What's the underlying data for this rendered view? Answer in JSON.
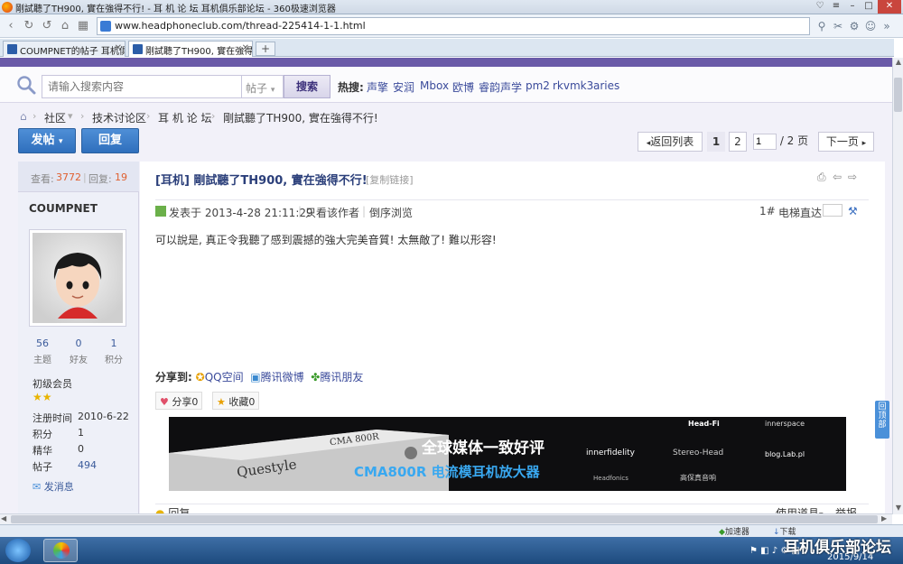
{
  "window": {
    "title": "剛試聽了TH900, 實在強得不行! - 耳 机 论 坛 耳机俱乐部论坛 - 360极速浏览器"
  },
  "browser": {
    "url": "www.headphoneclub.com/thread-225414-1-1.html",
    "tabs": [
      {
        "label": "COUMPNET的帖子 耳机俱乐"
      },
      {
        "label": "剛試聽了TH900, 實在強得"
      }
    ],
    "new_tab": "+"
  },
  "search": {
    "placeholder": "请输入搜索内容",
    "type": "帖子",
    "button": "搜索",
    "hot_label": "热搜:",
    "hot_terms": [
      "声擎",
      "安润",
      "Mbox",
      "欧博",
      "睿韵声学",
      "pm2",
      "rkvmk3",
      "aries"
    ]
  },
  "breadcrumb": [
    "社区",
    "技术讨论区",
    "耳 机 论 坛",
    "剛試聽了TH900, 實在強得不行!"
  ],
  "actions": {
    "post": "发帖",
    "reply": "回复"
  },
  "pagination": {
    "back": "返回列表",
    "pages": [
      "1",
      "2"
    ],
    "current": "1",
    "total": "/ 2 页",
    "next": "下一页"
  },
  "thread_stats": {
    "views_label": "查看:",
    "views": "3772",
    "sep": "|",
    "replies_label": "回复:",
    "replies": "19"
  },
  "author": {
    "name": "COUMPNET",
    "stats": [
      {
        "value": "56",
        "label": "主题"
      },
      {
        "value": "0",
        "label": "好友"
      },
      {
        "value": "1",
        "label": "积分"
      }
    ],
    "rank": "初级会员",
    "info": [
      {
        "label": "注册时间",
        "value": "2010-6-22"
      },
      {
        "label": "积分",
        "value": "1"
      },
      {
        "label": "精华",
        "value": "0"
      },
      {
        "label": "帖子",
        "value": "494"
      }
    ],
    "message": "发消息"
  },
  "post": {
    "title": "[耳机]  剛試聽了TH900, 實在強得不行!",
    "copy_link": "[复制链接]",
    "posted": "发表于 2013-4-28 21:11:29",
    "only_author": "只看该作者",
    "reverse": "倒序浏览",
    "floor": "1#",
    "elevator": "电梯直达",
    "body": "可以說是, 真正令我聽了感到震撼的強大完美音質! 太無敵了! 難以形容!",
    "share_label": "分享到:",
    "share_targets": [
      "QQ空间",
      "腾讯微博",
      "腾讯朋友"
    ],
    "share_btn": "分享0",
    "fav_btn": "收藏0",
    "reply_link": "回复",
    "use_tools": "使用道具",
    "report": "举报"
  },
  "banner": {
    "headline": "全球媒体一致好评",
    "subline": "CMA800R 电流模耳机放大器",
    "brand": "Questyle",
    "model": "CMA 800R",
    "logos": [
      "Head-Fi",
      "innerspace",
      "innerfidelity",
      "Stereo-Head",
      "blog.Lab.pl",
      "Headfonics",
      "高保真音响"
    ]
  },
  "side_tab": "回顶部",
  "status": {
    "accelerator": "加速器",
    "download": "下载"
  },
  "watermark": "耳机俱乐部论坛",
  "taskbar": {
    "date": "2015/9/14"
  },
  "colors": {
    "nav": "#6a5aa8",
    "link": "#3b4b9b",
    "button": "#2f6fbd",
    "accent": "#e06030"
  }
}
